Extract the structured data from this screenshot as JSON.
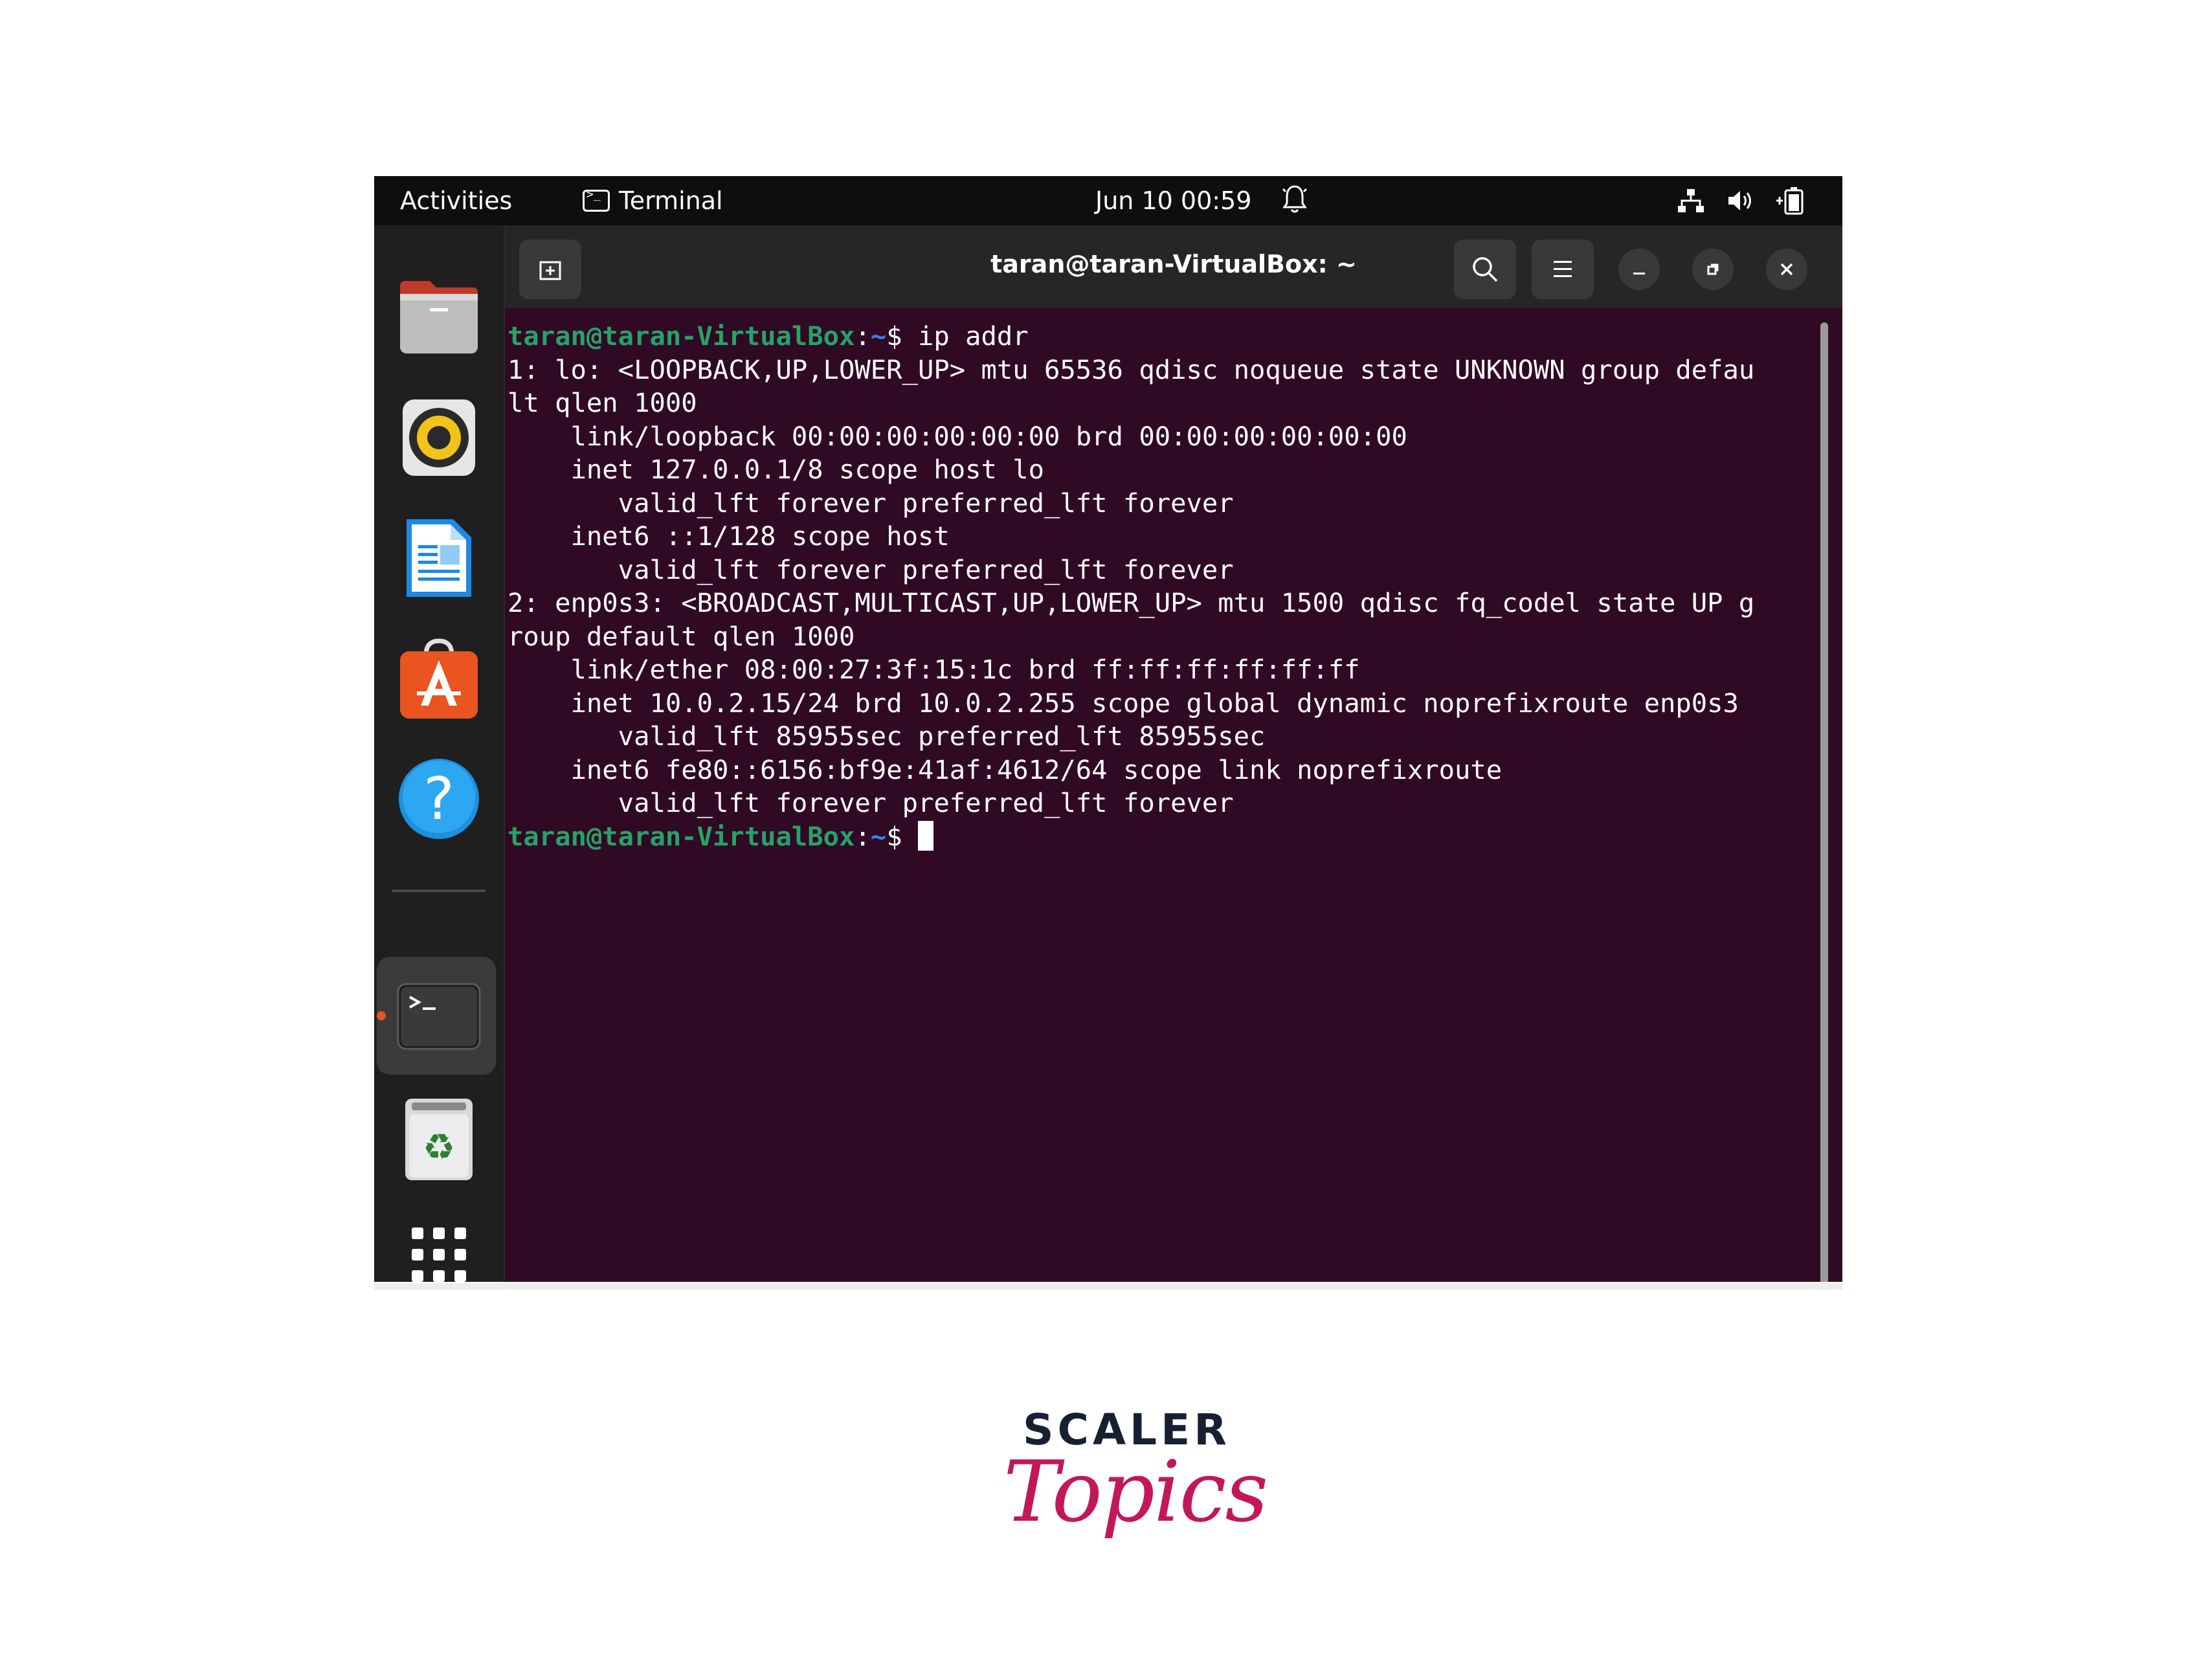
{
  "topbar": {
    "activities": "Activities",
    "app_name": "Terminal",
    "clock": "Jun 10  00:59",
    "icons": [
      "notification-bell-icon",
      "network-icon",
      "volume-icon",
      "battery-icon"
    ]
  },
  "dock": {
    "items": [
      {
        "name": "files",
        "icon": "files-folder-icon"
      },
      {
        "name": "rhythmbox",
        "icon": "speaker-icon"
      },
      {
        "name": "libreoffice-writer",
        "icon": "document-icon"
      },
      {
        "name": "ubuntu-software",
        "icon": "software-store-icon"
      },
      {
        "name": "help",
        "icon": "help-icon",
        "glyph": "?"
      },
      {
        "name": "terminal",
        "icon": "terminal-icon",
        "glyph": ">_",
        "active": true
      },
      {
        "name": "trash",
        "icon": "trash-icon",
        "glyph": "♻"
      },
      {
        "name": "show-applications",
        "icon": "app-grid-icon"
      }
    ],
    "active_indicator_color": "#e95420"
  },
  "window": {
    "title": "taran@taran-VirtualBox: ~",
    "buttons": [
      "new-tab-icon",
      "search-icon",
      "hamburger-menu-icon",
      "minimize-icon",
      "restore-icon",
      "close-icon"
    ]
  },
  "terminal": {
    "prompt": {
      "user": "taran@taran-VirtualBox",
      "sep": ":",
      "path": "~",
      "symbol": "$ "
    },
    "command": "ip addr",
    "output": [
      "1: lo: <LOOPBACK,UP,LOWER_UP> mtu 65536 qdisc noqueue state UNKNOWN group defau",
      "lt qlen 1000",
      "    link/loopback 00:00:00:00:00:00 brd 00:00:00:00:00:00",
      "    inet 127.0.0.1/8 scope host lo",
      "       valid_lft forever preferred_lft forever",
      "    inet6 ::1/128 scope host",
      "       valid_lft forever preferred_lft forever",
      "2: enp0s3: <BROADCAST,MULTICAST,UP,LOWER_UP> mtu 1500 qdisc fq_codel state UP g",
      "roup default qlen 1000",
      "    link/ether 08:00:27:3f:15:1c brd ff:ff:ff:ff:ff:ff",
      "    inet 10.0.2.15/24 brd 10.0.2.255 scope global dynamic noprefixroute enp0s3",
      "       valid_lft 85955sec preferred_lft 85955sec",
      "    inet6 fe80::6156:bf9e:41af:4612/64 scope link noprefixroute",
      "       valid_lft forever preferred_lft forever"
    ],
    "colors": {
      "background": "#300a24",
      "user": "#26a269",
      "path": "#3584e4",
      "text": "#ffffff"
    }
  },
  "logo": {
    "line1": "SCALER",
    "line2": "Topics",
    "color": "#c2185b"
  }
}
